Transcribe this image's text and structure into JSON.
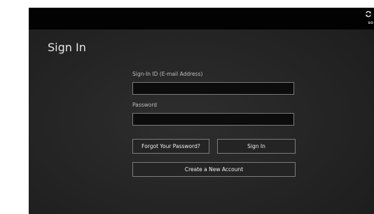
{
  "title": "Sign In",
  "topbar": {
    "sync_icon": "sync-icon",
    "sync_label": "SO"
  },
  "form": {
    "signin_id_label": "Sign-In ID (E-mail Address)",
    "signin_id_value": "",
    "password_label": "Password",
    "password_value": ""
  },
  "buttons": {
    "forgot_password": "Forgot Your Password?",
    "sign_in": "Sign In",
    "create_account": "Create a New Account"
  },
  "colors": {
    "background": "#252525",
    "topbar": "#020202",
    "input_background": "#0c0c0c",
    "border": "#7c7c7c",
    "text": "#e6e6e6"
  }
}
